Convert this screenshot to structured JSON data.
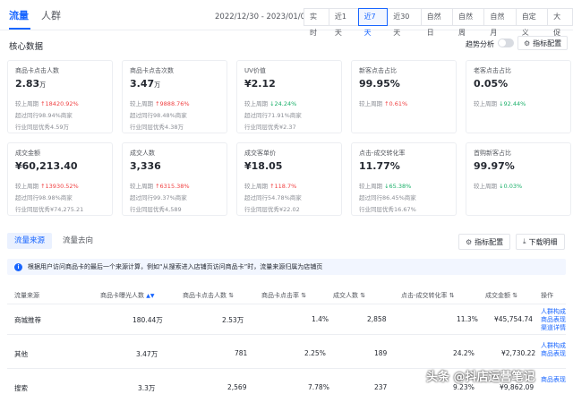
{
  "tabs": [
    "流量",
    "人群"
  ],
  "date_range": "2022/12/30 - 2023/01/05",
  "ranges": [
    "实时",
    "近1天",
    "近7天",
    "近30天",
    "自然日",
    "自然周",
    "自然月",
    "自定义",
    "大促"
  ],
  "active_range": "近7天",
  "core": {
    "title": "核心数据",
    "trend_label": "趋势分析",
    "config_label": "指标配置"
  },
  "cards": [
    {
      "label": "商品卡点击人数",
      "value": "2.83",
      "unit": "万",
      "l1a": "较上周期",
      "l1b": "18420.92%",
      "dir": "up",
      "l2": "超过同行98.94%商家",
      "l3": "行业同层优秀4.59万"
    },
    {
      "label": "商品卡点击次数",
      "value": "3.47",
      "unit": "万",
      "l1a": "较上周期",
      "l1b": "9888.76%",
      "dir": "up",
      "l2": "超过同行98.48%商家",
      "l3": "行业同层优秀4.38万"
    },
    {
      "label": "UV价值",
      "value": "¥2.12",
      "unit": "",
      "l1a": "较上周期",
      "l1b": "24.24%",
      "dir": "down",
      "l2": "超过同行71.91%商家",
      "l3": "行业同层优秀¥2.37"
    },
    {
      "label": "新客点击占比",
      "value": "99.95%",
      "unit": "",
      "l1a": "较上周期",
      "l1b": "0.61%",
      "dir": "up",
      "l2": "",
      "l3": ""
    },
    {
      "label": "老客点击占比",
      "value": "0.05%",
      "unit": "",
      "l1a": "较上周期",
      "l1b": "92.44%",
      "dir": "down",
      "l2": "",
      "l3": ""
    },
    {
      "label": "成交金额",
      "value": "¥60,213.40",
      "unit": "",
      "l1a": "较上周期",
      "l1b": "13930.52%",
      "dir": "up",
      "l2": "超过同行98.98%商家",
      "l3": "行业同层优秀¥74,275.21"
    },
    {
      "label": "成交人数",
      "value": "3,336",
      "unit": "",
      "l1a": "较上周期",
      "l1b": "6315.38%",
      "dir": "up",
      "l2": "超过同行99.37%商家",
      "l3": "行业同层优秀4,589"
    },
    {
      "label": "成交客单价",
      "value": "¥18.05",
      "unit": "",
      "l1a": "较上周期",
      "l1b": "118.7%",
      "dir": "up",
      "l2": "超过同行54.78%商家",
      "l3": "行业同层优秀¥22.02"
    },
    {
      "label": "点击-成交转化率",
      "value": "11.77%",
      "unit": "",
      "l1a": "较上周期",
      "l1b": "65.38%",
      "dir": "down",
      "l2": "超过同行86.45%商家",
      "l3": "行业同层优秀16.67%"
    },
    {
      "label": "首购新客占比",
      "value": "99.97%",
      "unit": "",
      "l1a": "较上周期",
      "l1b": "0.03%",
      "dir": "down",
      "l2": "",
      "l3": ""
    }
  ],
  "lower": {
    "sub_tabs": [
      "流量来源",
      "流量去向"
    ],
    "config_label": "指标配置",
    "download_label": "下载明细",
    "notice": "根据用户访问商品卡的最后一个来源计算，例如“从搜索进入店铺页访问商品卡”时，流量来源归属为店铺页"
  },
  "table": {
    "headers": [
      "流量来源",
      "商品卡曝光人数",
      "商品卡点击人数",
      "商品卡点击率",
      "成交人数",
      "点击-成交转化率",
      "成交金额",
      "操作"
    ],
    "rows": [
      {
        "source": "商城推荐",
        "exposure": "180.44万",
        "clicks": "2.53万",
        "ctr": "1.4%",
        "buyers": "2,858",
        "cvr": "11.3%",
        "gmv": "¥45,754.74",
        "actions": [
          "人群构成",
          "商品表现",
          "渠道详情"
        ]
      },
      {
        "source": "其他",
        "exposure": "3.47万",
        "clicks": "781",
        "ctr": "2.25%",
        "buyers": "189",
        "cvr": "24.2%",
        "gmv": "¥2,730.22",
        "actions": [
          "人群构成",
          "商品表现"
        ]
      },
      {
        "source": "搜索",
        "exposure": "3.3万",
        "clicks": "2,569",
        "ctr": "7.78%",
        "buyers": "237",
        "cvr": "9.23%",
        "gmv": "¥9,862.09",
        "actions": [
          "商品表现"
        ]
      }
    ]
  },
  "watermark": "头条 @抖店运营笔记"
}
